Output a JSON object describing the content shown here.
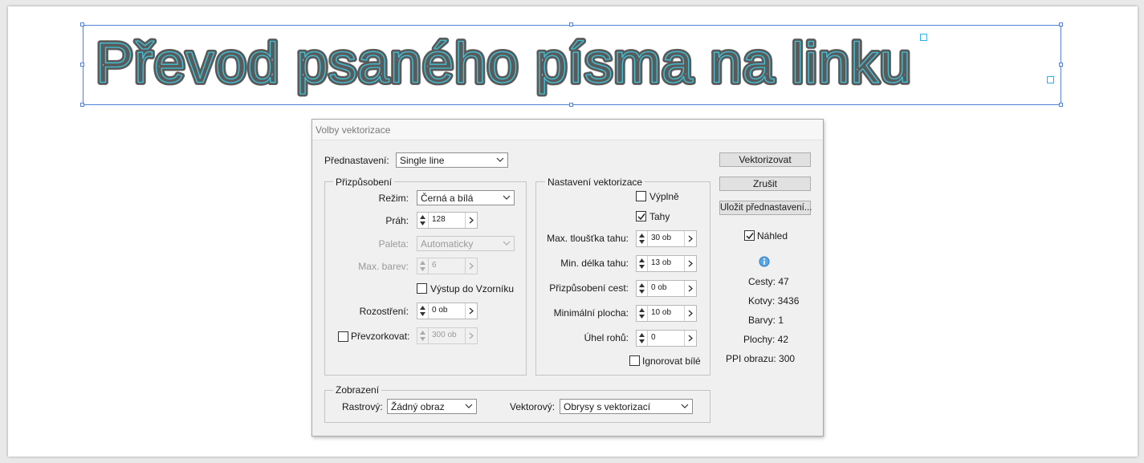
{
  "artwork": {
    "text": "Převod psaného písma na linku"
  },
  "dialog": {
    "title": "Volby vektorizace",
    "preset": {
      "label": "Přednastavení:",
      "value": "Single line"
    },
    "adjust": {
      "legend": "Přizpůsobení",
      "mode": {
        "label": "Režim:",
        "value": "Černá a bílá"
      },
      "threshold": {
        "label": "Práh:",
        "value": "128"
      },
      "palette": {
        "label": "Paleta:",
        "value": "Automaticky"
      },
      "max_colors": {
        "label": "Max. barev:",
        "value": "6"
      },
      "output_swatches": {
        "label": "Výstup do Vzorníku",
        "checked": false
      },
      "blur": {
        "label": "Rozostření:",
        "value": "0 ob"
      },
      "resample": {
        "label": "Převzorkovat:",
        "value": "300 ob",
        "checked": false
      }
    },
    "trace": {
      "legend": "Nastavení vektorizace",
      "fills": {
        "label": "Výplně",
        "checked": false
      },
      "strokes": {
        "label": "Tahy",
        "checked": true
      },
      "max_stroke": {
        "label": "Max. tloušťka tahu:",
        "value": "30 ob"
      },
      "min_stroke": {
        "label": "Min. délka tahu:",
        "value": "13 ob"
      },
      "path_fit": {
        "label": "Přizpůsobení cest:",
        "value": "0 ob"
      },
      "min_area": {
        "label": "Minimální plocha:",
        "value": "10 ob"
      },
      "corner_angle": {
        "label": "Úhel rohů:",
        "value": "0"
      },
      "ignore_white": {
        "label": "Ignorovat bílé",
        "checked": false
      }
    },
    "view": {
      "legend": "Zobrazení",
      "raster": {
        "label": "Rastrový:",
        "value": "Žádný obraz"
      },
      "vector": {
        "label": "Vektorový:",
        "value": "Obrysy s vektorizací"
      }
    },
    "buttons": {
      "trace": "Vektorizovat",
      "cancel": "Zrušit",
      "save_preset": "Uložit přednastavení..."
    },
    "preview": {
      "label": "Náhled",
      "checked": true
    },
    "stats": {
      "paths": "Cesty: 47",
      "anchors": "Kotvy: 3436",
      "colors": "Barvy: 1",
      "areas": "Plochy: 42",
      "ppi": "PPI obrazu: 300"
    },
    "colors": {
      "accent": "#4f7fd6",
      "outline": "#4a4a4a",
      "trace_line": "#3fc1d8"
    }
  }
}
